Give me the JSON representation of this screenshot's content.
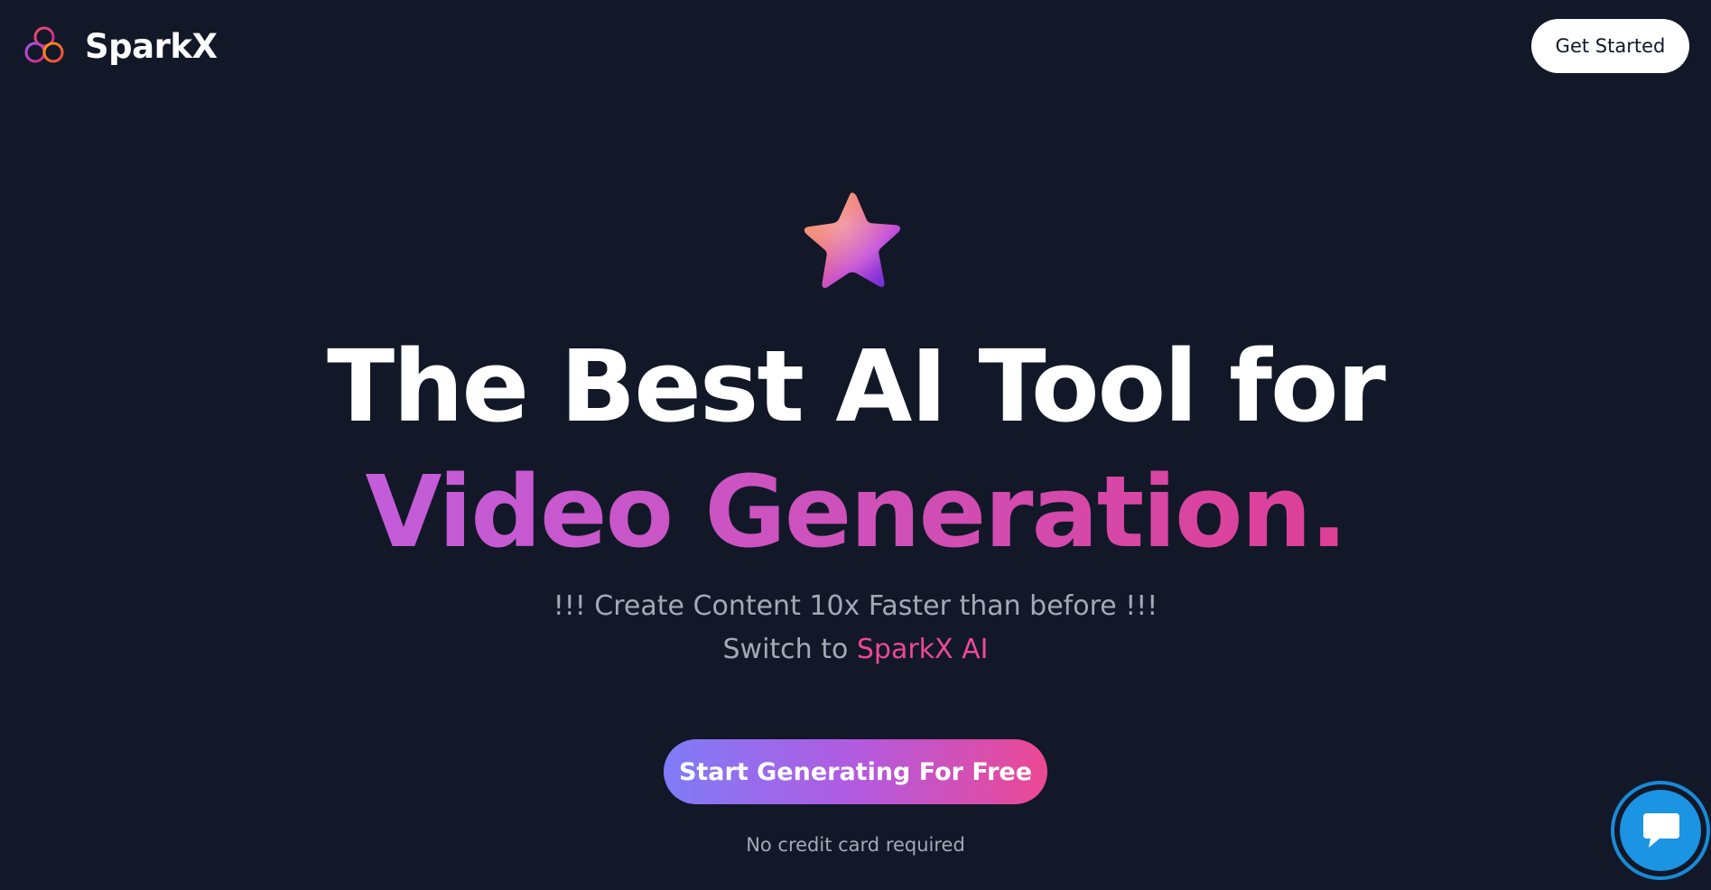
{
  "header": {
    "brand_name": "SparkX",
    "logo_icon": "interlinked-rings-logo-icon",
    "get_started_label": "Get Started"
  },
  "hero": {
    "star_icon": "gradient-star-icon",
    "headline_line1": "The Best AI Tool for",
    "headline_line2": "Video Generation.",
    "tagline": "!!! Create Content 10x Faster than before !!!",
    "switch_prefix": "Switch to ",
    "switch_brand": "SparkX AI",
    "cta_label": "Start Generating For Free",
    "note": "No credit card required"
  },
  "chat": {
    "icon": "chat-bubble-icon"
  },
  "colors": {
    "background": "#121828",
    "accent_pink": "#ec4899",
    "accent_purple": "#c35ddb",
    "muted_text": "#a4a9b4",
    "chat_blue": "#1b94e3"
  }
}
